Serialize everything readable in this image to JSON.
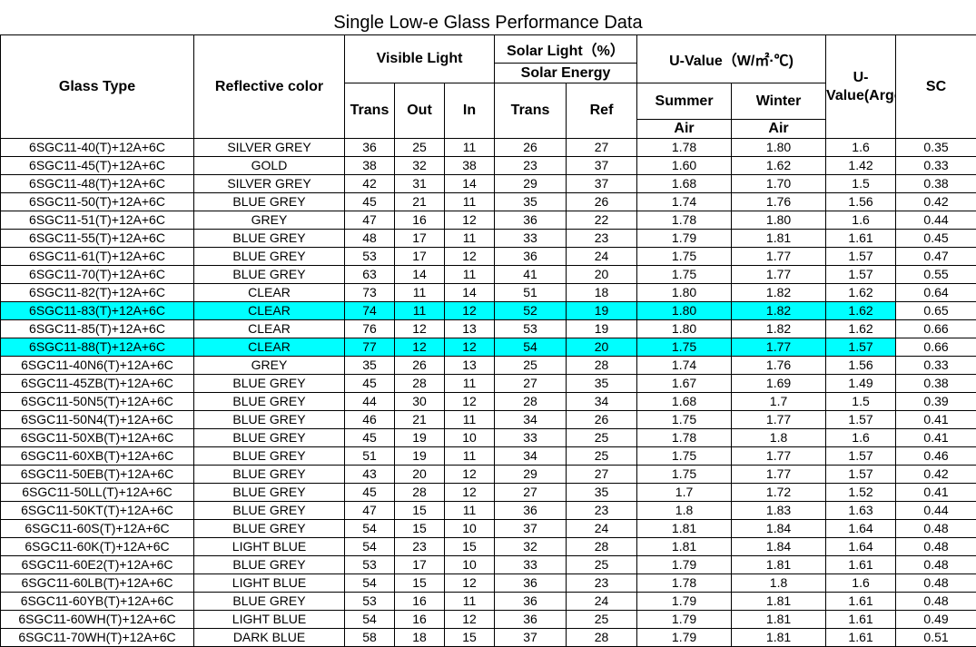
{
  "title": "Single Low-e Glass Performance Data",
  "headers": {
    "glass_type": "Glass Type",
    "reflective_color": "Reflective color",
    "visible_light": "Visible Light",
    "solar_light": "Solar Light（%）",
    "solar_energy": "Solar Energy",
    "u_value": "U-Value（W/㎡·℃)",
    "u_value_argon": "U-Value(Argon)",
    "sc": "SC",
    "trans": "Trans",
    "out": "Out",
    "in": "In",
    "solar_trans": "Trans",
    "ref": "Ref",
    "summer": "Summer",
    "winter": "Winter",
    "summer_air": "Air",
    "winter_air": "Air"
  },
  "highlight_color": "#00ffff",
  "rows": [
    [
      "6SGC11-40(T)+12A+6C",
      "SILVER GREY",
      "36",
      "25",
      "11",
      "26",
      "27",
      "1.78",
      "1.80",
      "1.6",
      "0.35"
    ],
    [
      "6SGC11-45(T)+12A+6C",
      "GOLD",
      "38",
      "32",
      "38",
      "23",
      "37",
      "1.60",
      "1.62",
      "1.42",
      "0.33"
    ],
    [
      "6SGC11-48(T)+12A+6C",
      "SILVER GREY",
      "42",
      "31",
      "14",
      "29",
      "37",
      "1.68",
      "1.70",
      "1.5",
      "0.38"
    ],
    [
      "6SGC11-50(T)+12A+6C",
      "BLUE GREY",
      "45",
      "21",
      "11",
      "35",
      "26",
      "1.74",
      "1.76",
      "1.56",
      "0.42"
    ],
    [
      "6SGC11-51(T)+12A+6C",
      "GREY",
      "47",
      "16",
      "12",
      "36",
      "22",
      "1.78",
      "1.80",
      "1.6",
      "0.44"
    ],
    [
      "6SGC11-55(T)+12A+6C",
      "BLUE GREY",
      "48",
      "17",
      "11",
      "33",
      "23",
      "1.79",
      "1.81",
      "1.61",
      "0.45"
    ],
    [
      "6SGC11-61(T)+12A+6C",
      "BLUE GREY",
      "53",
      "17",
      "12",
      "36",
      "24",
      "1.75",
      "1.77",
      "1.57",
      "0.47"
    ],
    [
      "6SGC11-70(T)+12A+6C",
      "BLUE GREY",
      "63",
      "14",
      "11",
      "41",
      "20",
      "1.75",
      "1.77",
      "1.57",
      "0.55"
    ],
    [
      "6SGC11-82(T)+12A+6C",
      "CLEAR",
      "73",
      "11",
      "14",
      "51",
      "18",
      "1.80",
      "1.82",
      "1.62",
      "0.64"
    ],
    [
      "6SGC11-83(T)+12A+6C",
      "CLEAR",
      "74",
      "11",
      "12",
      "52",
      "19",
      "1.80",
      "1.82",
      "1.62",
      "0.65"
    ],
    [
      "6SGC11-85(T)+12A+6C",
      "CLEAR",
      "76",
      "12",
      "13",
      "53",
      "19",
      "1.80",
      "1.82",
      "1.62",
      "0.66"
    ],
    [
      "6SGC11-88(T)+12A+6C",
      "CLEAR",
      "77",
      "12",
      "12",
      "54",
      "20",
      "1.75",
      "1.77",
      "1.57",
      "0.66"
    ],
    [
      "6SGC11-40N6(T)+12A+6C",
      "GREY",
      "35",
      "26",
      "13",
      "25",
      "28",
      "1.74",
      "1.76",
      "1.56",
      "0.33"
    ],
    [
      "6SGC11-45ZB(T)+12A+6C",
      "BLUE GREY",
      "45",
      "28",
      "11",
      "27",
      "35",
      "1.67",
      "1.69",
      "1.49",
      "0.38"
    ],
    [
      "6SGC11-50N5(T)+12A+6C",
      "BLUE GREY",
      "44",
      "30",
      "12",
      "28",
      "34",
      "1.68",
      "1.7",
      "1.5",
      "0.39"
    ],
    [
      "6SGC11-50N4(T)+12A+6C",
      "BLUE GREY",
      "46",
      "21",
      "11",
      "34",
      "26",
      "1.75",
      "1.77",
      "1.57",
      "0.41"
    ],
    [
      "6SGC11-50XB(T)+12A+6C",
      "BLUE GREY",
      "45",
      "19",
      "10",
      "33",
      "25",
      "1.78",
      "1.8",
      "1.6",
      "0.41"
    ],
    [
      "6SGC11-60XB(T)+12A+6C",
      "BLUE GREY",
      "51",
      "19",
      "11",
      "34",
      "25",
      "1.75",
      "1.77",
      "1.57",
      "0.46"
    ],
    [
      "6SGC11-50EB(T)+12A+6C",
      "BLUE GREY",
      "43",
      "20",
      "12",
      "29",
      "27",
      "1.75",
      "1.77",
      "1.57",
      "0.42"
    ],
    [
      "6SGC11-50LL(T)+12A+6C",
      "BLUE GREY",
      "45",
      "28",
      "12",
      "27",
      "35",
      "1.7",
      "1.72",
      "1.52",
      "0.41"
    ],
    [
      "6SGC11-50KT(T)+12A+6C",
      "BLUE GREY",
      "47",
      "15",
      "11",
      "36",
      "23",
      "1.8",
      "1.83",
      "1.63",
      "0.44"
    ],
    [
      "6SGC11-60S(T)+12A+6C",
      "BLUE GREY",
      "54",
      "15",
      "10",
      "37",
      "24",
      "1.81",
      "1.84",
      "1.64",
      "0.48"
    ],
    [
      "6SGC11-60K(T)+12A+6C",
      "LIGHT BLUE",
      "54",
      "23",
      "15",
      "32",
      "28",
      "1.81",
      "1.84",
      "1.64",
      "0.48"
    ],
    [
      "6SGC11-60E2(T)+12A+6C",
      "BLUE GREY",
      "53",
      "17",
      "10",
      "33",
      "25",
      "1.79",
      "1.81",
      "1.61",
      "0.48"
    ],
    [
      "6SGC11-60LB(T)+12A+6C",
      "LIGHT BLUE",
      "54",
      "15",
      "12",
      "36",
      "23",
      "1.78",
      "1.8",
      "1.6",
      "0.48"
    ],
    [
      "6SGC11-60YB(T)+12A+6C",
      "BLUE GREY",
      "53",
      "16",
      "11",
      "36",
      "24",
      "1.79",
      "1.81",
      "1.61",
      "0.48"
    ],
    [
      "6SGC11-60WH(T)+12A+6C",
      "LIGHT BLUE",
      "54",
      "16",
      "12",
      "36",
      "25",
      "1.79",
      "1.81",
      "1.61",
      "0.49"
    ],
    [
      "6SGC11-70WH(T)+12A+6C",
      "DARK BLUE",
      "58",
      "18",
      "15",
      "37",
      "28",
      "1.79",
      "1.81",
      "1.61",
      "0.51"
    ]
  ],
  "highlighted_rows": [
    9,
    11
  ]
}
